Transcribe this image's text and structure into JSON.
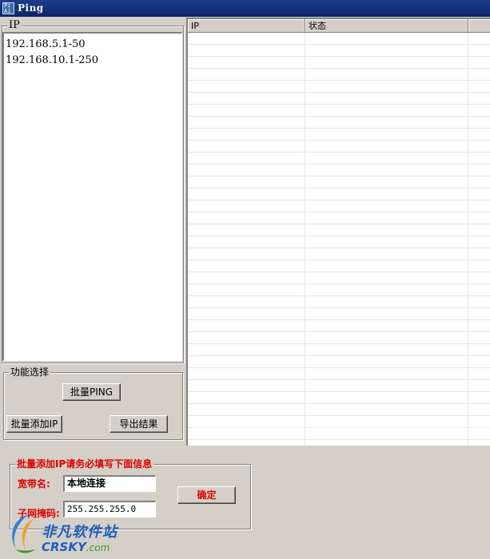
{
  "window": {
    "title": "Ping",
    "icon_text": "Pi\nAi"
  },
  "ip_group": {
    "legend": "IP",
    "lines": [
      "192.168.5.1-50",
      "192.168.10.1-250"
    ]
  },
  "func_group": {
    "legend": "功能选择",
    "batch_ping_label": "批量PING",
    "batch_add_ip_label": "批量添加IP",
    "export_label": "导出结果"
  },
  "results": {
    "columns": [
      "IP",
      "状态",
      ""
    ]
  },
  "batch_form": {
    "legend": "批量添加IP请务必填写下面信息",
    "broadband_label": "宽带名:",
    "broadband_value": "本地连接",
    "mask_label": "子网掩码:",
    "mask_value": "255.255.255.0",
    "confirm_label": "确定"
  },
  "watermark": {
    "cn": "非凡软件站",
    "en": "CRSKY",
    "en_suffix": ".com"
  },
  "colors": {
    "title_bar": "#0a246a",
    "accent_red": "#e00000",
    "face": "#d4d0c8"
  }
}
